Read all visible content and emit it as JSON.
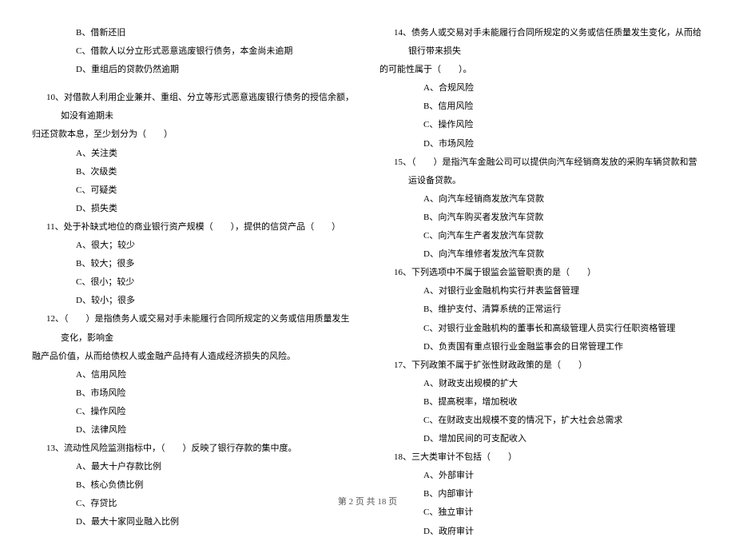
{
  "left": {
    "pre_opts": [
      "B、借新还旧",
      "C、借款人以分立形式恶意逃废银行债务，本金尚未逾期",
      "D、重组后的贷款仍然逾期"
    ],
    "q10": {
      "text": "10、对借款人利用企业兼并、重组、分立等形式恶意逃废银行债务的授信余额，如没有逾期未",
      "cont": "归还贷款本息，至少划分为（　　）",
      "opts": [
        "A、关注类",
        "B、次级类",
        "C、可疑类",
        "D、损失类"
      ]
    },
    "q11": {
      "text": "11、处于补缺式地位的商业银行资产规模（　　），提供的信贷产品（　　）",
      "opts": [
        "A、很大；较少",
        "B、较大；很多",
        "C、很小；较少",
        "D、较小；很多"
      ]
    },
    "q12": {
      "text": "12、（　　）是指债务人或交易对手未能履行合同所规定的义务或信用质量发生变化，影响金",
      "cont": "融产品价值，从而给债权人或金融产品持有人造成经济损失的风险。",
      "opts": [
        "A、信用风险",
        "B、市场风险",
        "C、操作风险",
        "D、法律风险"
      ]
    },
    "q13": {
      "text": "13、流动性风险监测指标中，（　　）反映了银行存款的集中度。",
      "opts": [
        "A、最大十户存款比例",
        "B、核心负债比例",
        "C、存贷比",
        "D、最大十家同业融入比例"
      ]
    }
  },
  "right": {
    "q14": {
      "text": "14、债务人或交易对手未能履行合同所规定的义务或信任质量发生变化，从而给银行带来损失",
      "cont": "的可能性属于（　　）。",
      "opts": [
        "A、合规风险",
        "B、信用风险",
        "C、操作风险",
        "D、市场风险"
      ]
    },
    "q15": {
      "text": "15、（　　）是指汽车金融公司可以提供向汽车经销商发放的采购车辆贷款和营运设备贷款。",
      "opts": [
        "A、向汽车经销商发放汽车贷款",
        "B、向汽车购买者发放汽车贷款",
        "C、向汽车生产者发放汽车贷款",
        "D、向汽车维修者发放汽车贷款"
      ]
    },
    "q16": {
      "text": "16、下列选项中不属于银监会监管职责的是（　　）",
      "opts": [
        "A、对银行业金融机构实行并表监督管理",
        "B、维护支付、清算系统的正常运行",
        "C、对银行业金融机构的董事长和高级管理人员实行任职资格管理",
        "D、负责国有重点银行业金融监事会的日常管理工作"
      ]
    },
    "q17": {
      "text": "17、下列政策不属于扩张性财政政策的是（　　）",
      "opts": [
        "A、财政支出规模的扩大",
        "B、提高税率，增加税收",
        "C、在财政支出规模不变的情况下，扩大社会总需求",
        "D、增加民间的可支配收入"
      ]
    },
    "q18": {
      "text": "18、三大类审计不包括（　　）",
      "opts": [
        "A、外部审计",
        "B、内部审计",
        "C、独立审计",
        "D、政府审计"
      ]
    }
  },
  "footer": "第 2 页 共 18 页"
}
